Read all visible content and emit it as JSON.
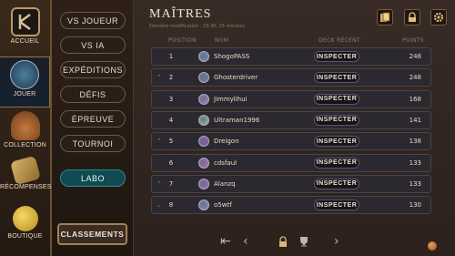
{
  "left_nav": [
    {
      "label": "ACCUEIL",
      "icon": "home-logo-icon"
    },
    {
      "label": "JOUER",
      "icon": "play-shield-icon",
      "active": true
    },
    {
      "label": "COLLECTION",
      "icon": "collection-bag-icon"
    },
    {
      "label": "RÉCOMPENSES",
      "icon": "scroll-icon"
    },
    {
      "label": "BOUTIQUE",
      "icon": "coins-icon"
    }
  ],
  "modes": [
    "VS JOUEUR",
    "VS IA",
    "EXPÉDITIONS",
    "DÉFIS",
    "ÉPREUVE",
    "TOURNOI",
    "LABO"
  ],
  "ranking_button": "CLASSEMENTS",
  "header": {
    "title": "MAÎTRES",
    "subtitle": "Dernière modification : 23:36, 25 minutes"
  },
  "columns": {
    "position": "POSITION",
    "name": "NOM",
    "deck": "DECK RÉCENT",
    "points": "POINTS"
  },
  "inspect_label": "INSPECTER",
  "rows": [
    {
      "trend": "",
      "position": "1",
      "name": "ShogoPASS",
      "points": "248",
      "avatar_color": "#6b8dd6"
    },
    {
      "trend": "up",
      "position": "2",
      "name": "Ghosterdriver",
      "points": "248",
      "avatar_color": "#5a7fc8"
    },
    {
      "trend": "",
      "position": "3",
      "name": "Jimmylihui",
      "points": "168",
      "avatar_color": "#a478d8"
    },
    {
      "trend": "",
      "position": "4",
      "name": "Ultraman1996",
      "points": "141",
      "avatar_color": "#8ec6b0"
    },
    {
      "trend": "up",
      "position": "5",
      "name": "Dreigon",
      "points": "138",
      "avatar_color": "#8a4ed0"
    },
    {
      "trend": "",
      "position": "6",
      "name": "cdsfaul",
      "points": "133",
      "avatar_color": "#b468d6"
    },
    {
      "trend": "up",
      "position": "7",
      "name": "Alanzq",
      "points": "133",
      "avatar_color": "#9a66d8"
    },
    {
      "trend": "down",
      "position": "8",
      "name": "o5wtf",
      "points": "130",
      "avatar_color": "#7e8ee0"
    }
  ],
  "trend_glyphs": {
    "up": "⌃",
    "down": "⌄"
  },
  "colors": {
    "labo": "#0f4b51",
    "up": "#4fc36a",
    "down": "#d25a3a"
  }
}
